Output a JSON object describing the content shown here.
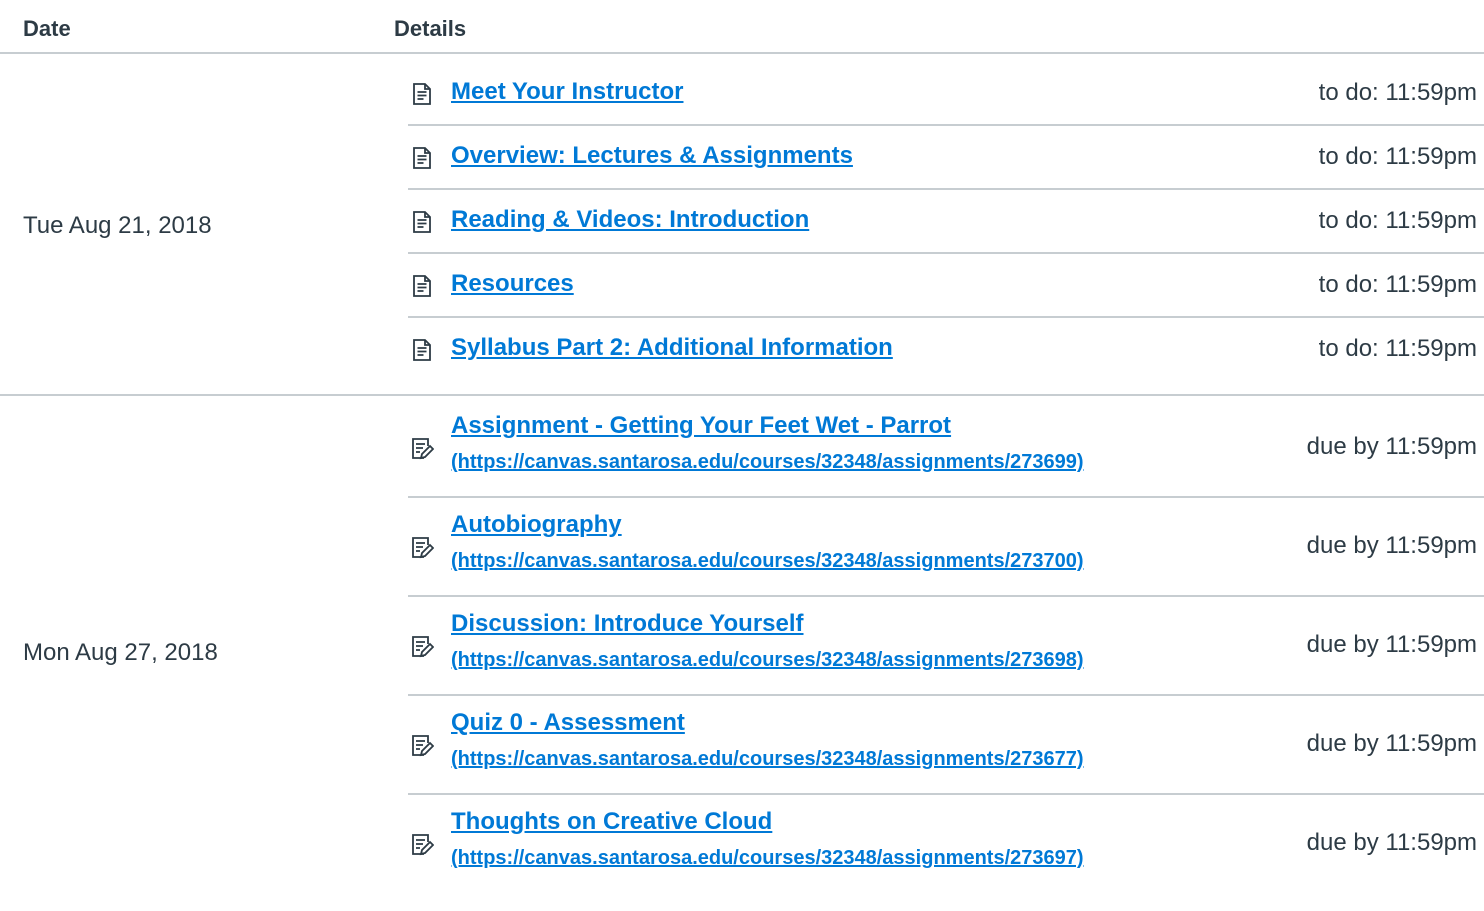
{
  "header": {
    "date": "Date",
    "details": "Details"
  },
  "groups": [
    {
      "date": "Tue Aug 21, 2018",
      "items": [
        {
          "title": "Meet Your Instructor",
          "when": "to do: 11:59pm",
          "icon": "page-icon"
        },
        {
          "title": "Overview: Lectures & Assignments",
          "when": "to do: 11:59pm",
          "icon": "page-icon"
        },
        {
          "title": "Reading & Videos: Introduction",
          "when": "to do: 11:59pm",
          "icon": "page-icon"
        },
        {
          "title": "Resources",
          "when": "to do: 11:59pm",
          "icon": "page-icon"
        },
        {
          "title": "Syllabus Part 2: Additional Information",
          "when": "to do: 11:59pm",
          "icon": "page-icon"
        }
      ]
    },
    {
      "date": "Mon Aug 27, 2018",
      "items": [
        {
          "title": "Assignment - Getting Your Feet Wet - Parrot",
          "url": "(https://canvas.santarosa.edu/courses/32348/assignments/273699)",
          "when": "due by 11:59pm",
          "icon": "assignment-icon"
        },
        {
          "title": "Autobiography",
          "url": "(https://canvas.santarosa.edu/courses/32348/assignments/273700)",
          "when": "due by 11:59pm",
          "icon": "assignment-icon"
        },
        {
          "title": "Discussion: Introduce Yourself",
          "url": "(https://canvas.santarosa.edu/courses/32348/assignments/273698)",
          "when": "due by 11:59pm",
          "icon": "assignment-icon"
        },
        {
          "title": "Quiz 0 - Assessment",
          "url": "(https://canvas.santarosa.edu/courses/32348/assignments/273677)",
          "when": "due by 11:59pm",
          "icon": "assignment-icon"
        },
        {
          "title": "Thoughts on Creative Cloud",
          "url": "(https://canvas.santarosa.edu/courses/32348/assignments/273697)",
          "when": "due by 11:59pm",
          "icon": "assignment-icon"
        }
      ]
    }
  ],
  "colors": {
    "link": "#0079d6",
    "text": "#2d3b45",
    "divider": "#c7cdd1"
  }
}
